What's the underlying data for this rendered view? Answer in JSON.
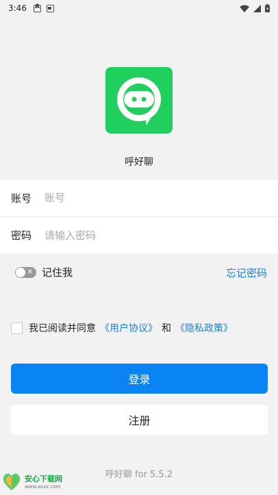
{
  "status_bar": {
    "time": "3:46"
  },
  "app": {
    "name": "呼好聊",
    "version_text": "呼好聊 for 5.5.2"
  },
  "form": {
    "account_label": "账号",
    "account_placeholder": "账号",
    "password_label": "密码",
    "password_placeholder": "请输入密码"
  },
  "remember": {
    "label": "记住我",
    "enabled": false,
    "forgot_label": "忘记密码"
  },
  "agreement": {
    "prefix": "我已阅读并同意",
    "user_agreement": "《用户协议》",
    "and": "和",
    "privacy_policy": "《隐私政策》",
    "checked": false
  },
  "buttons": {
    "login": "登录",
    "register": "注册"
  },
  "watermark": {
    "title": "安心下载网",
    "url": "www.anxz.com"
  },
  "colors": {
    "logo_green": "#21cf5f",
    "primary_blue": "#0a84f5",
    "link_blue": "#1e7fe0"
  }
}
